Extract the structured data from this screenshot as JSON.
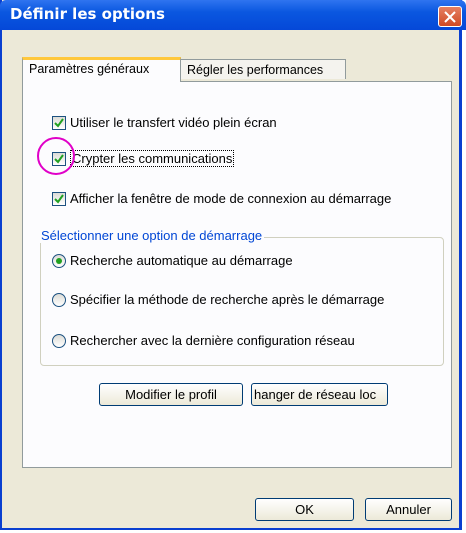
{
  "window": {
    "title": "Définir les options"
  },
  "tabs": [
    {
      "label": "Paramètres généraux"
    },
    {
      "label": "Régler les performances"
    }
  ],
  "options": {
    "fullscreen_video": {
      "label": "Utiliser le transfert vidéo plein écran",
      "checked": true
    },
    "encrypt_comms": {
      "label": "Crypter les communications",
      "checked": true
    },
    "show_connection_mode": {
      "label": "Afficher la fenêtre de mode de connexion au démarrage",
      "checked": true
    }
  },
  "startup": {
    "legend": "Sélectionner une option de démarrage",
    "choices": [
      {
        "label": "Recherche automatique au démarrage",
        "selected": true
      },
      {
        "label": "Spécifier la méthode de recherche après le démarrage",
        "selected": false
      },
      {
        "label": "Rechercher avec la dernière configuration réseau",
        "selected": false
      }
    ]
  },
  "buttons": {
    "modify_profile": "Modifier le profil",
    "change_network": "hanger de réseau loc",
    "ok": "OK",
    "cancel": "Annuler"
  },
  "colors": {
    "titlebar": "#0a57e0",
    "tab_highlight": "#ffc83c",
    "annotation_circle": "#e000c8",
    "radio_dot": "#21a121"
  }
}
